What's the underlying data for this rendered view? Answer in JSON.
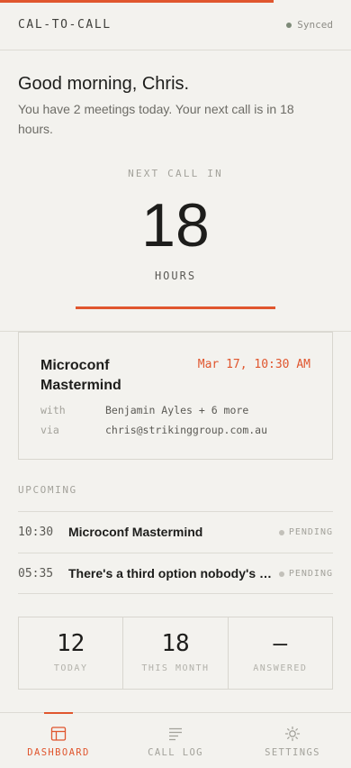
{
  "colors": {
    "accent": "#e0562e",
    "background": "#f3f2ee",
    "text": "#1d1d1b",
    "muted": "#a3a29b",
    "synced": "#7d8a78"
  },
  "header": {
    "brand": "CAL-TO-CALL",
    "sync_status": "Synced",
    "progress": 0.78
  },
  "greeting": {
    "title": "Good morning, Chris.",
    "subtitle": "You have 2 meetings today. Your next call is in 18 hours."
  },
  "countdown": {
    "label": "NEXT CALL IN",
    "value": "18",
    "unit": "HOURS"
  },
  "next_meeting": {
    "title": "Microconf Mastermind",
    "datetime": "Mar 17, 10:30 AM",
    "with_label": "with",
    "with_value": "Benjamin Ayles + 6 more",
    "via_label": "via",
    "via_value": "chris@strikinggroup.com.au"
  },
  "upcoming": {
    "label": "UPCOMING",
    "items": [
      {
        "time": "10:30",
        "title": "Microconf Mastermind",
        "status": "PENDING"
      },
      {
        "time": "05:35",
        "title": "There's a third option nobody's talking about",
        "status": "PENDING"
      }
    ]
  },
  "stats": [
    {
      "value": "12",
      "label": "TODAY"
    },
    {
      "value": "18",
      "label": "THIS MONTH"
    },
    {
      "value": "—",
      "label": "ANSWERED"
    }
  ],
  "nav": [
    {
      "label": "DASHBOARD",
      "icon": "dashboard-icon",
      "active": true
    },
    {
      "label": "CALL LOG",
      "icon": "call-log-icon",
      "active": false
    },
    {
      "label": "SETTINGS",
      "icon": "settings-icon",
      "active": false
    }
  ]
}
